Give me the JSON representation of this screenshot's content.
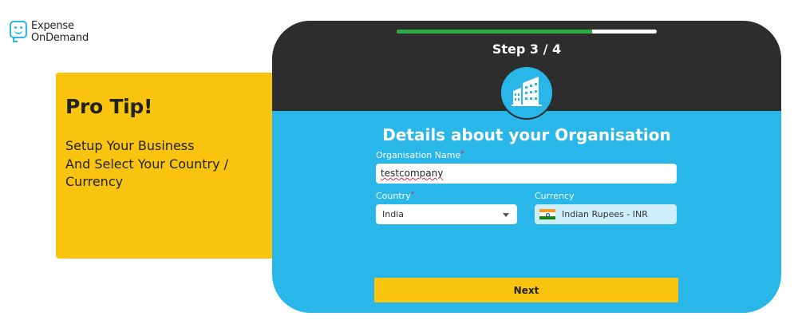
{
  "brand": {
    "line1": "Expense",
    "line2": "OnDemand",
    "accent": "#29b6e8"
  },
  "tip": {
    "title": "Pro Tip!",
    "line1": "Setup Your Business",
    "line2": "And Select Your Country /",
    "line3": "Currency",
    "color": "#f9c410"
  },
  "wizard": {
    "step_text": "Step 3 / 4",
    "progress": 0.75,
    "progress_color": "#2eaa44",
    "header_color": "#2d2d2d",
    "body_color": "#29b6e8",
    "icon": "building-icon",
    "title": "Details about your Organisation"
  },
  "form": {
    "org_name_label": "Organisation Name",
    "org_name_value": "testcompany",
    "country_label": "Country",
    "country_value": "India",
    "currency_label": "Currency",
    "currency_value": "Indian Rupees - INR",
    "required_mark": "*",
    "next_label": "Next"
  }
}
